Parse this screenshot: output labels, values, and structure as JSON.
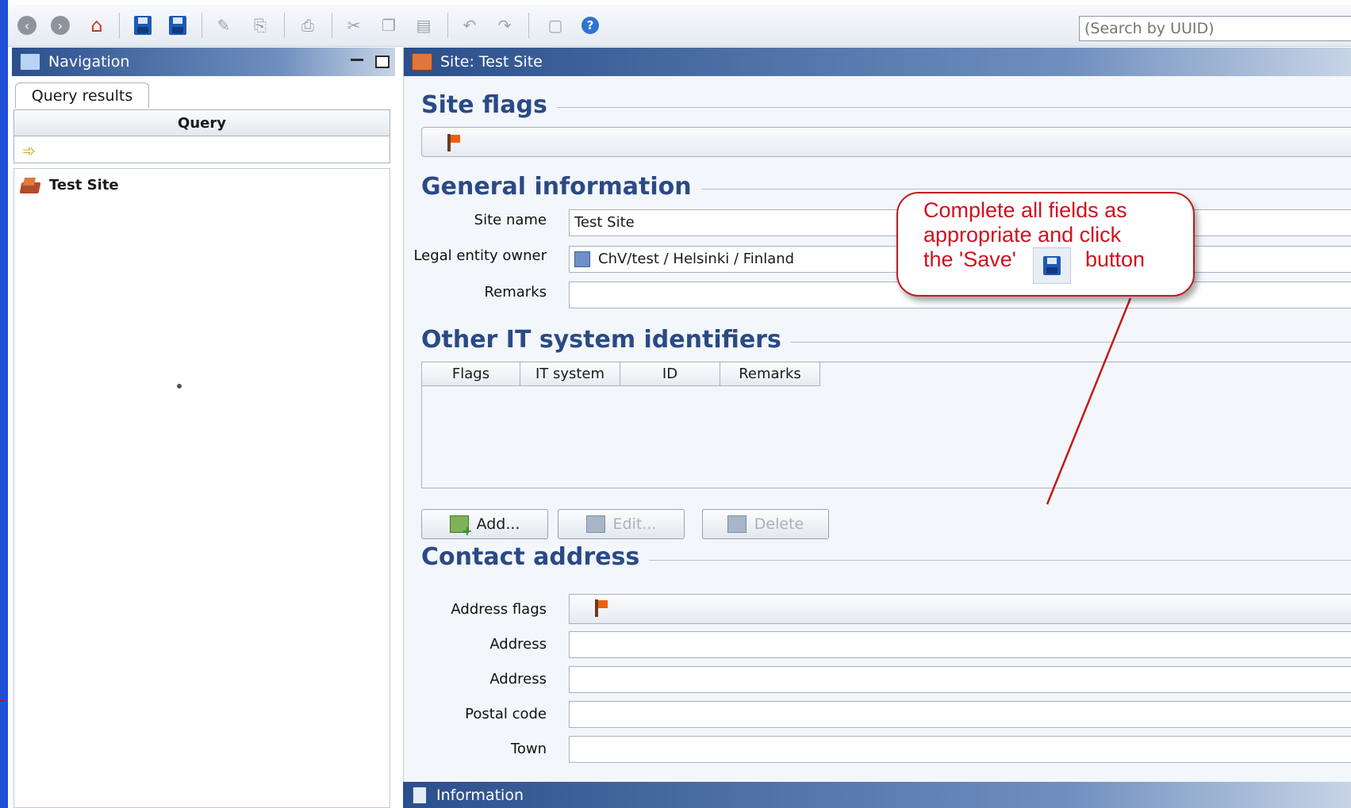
{
  "toolbar": {
    "icons": [
      "back-icon",
      "forward-icon",
      "home-icon",
      "save-icon",
      "save-all-icon",
      "edit-icon",
      "preview-icon",
      "print-icon",
      "cut-icon",
      "copy-icon",
      "paste-icon",
      "undo-icon",
      "redo-icon",
      "document-icon",
      "help-icon"
    ],
    "search_placeholder": "(Search by UUID)"
  },
  "navigation": {
    "title": "Navigation",
    "tab": "Query results",
    "query_header": "Query",
    "tree_items": [
      {
        "label": "Test Site",
        "icon": "site-icon"
      }
    ]
  },
  "site_panel": {
    "title": "Site: Test Site",
    "sections": {
      "flags": "Site flags",
      "general": "General information",
      "identifiers": "Other IT system identifiers",
      "contact": "Contact address"
    },
    "general": {
      "site_name_label": "Site name",
      "site_name_value": "Test Site",
      "owner_label": "Legal entity owner",
      "owner_value": "ChV/test / Helsinki / Finland",
      "remarks_label": "Remarks",
      "remarks_value": ""
    },
    "identifiers_table": {
      "columns": [
        "Flags",
        "IT system",
        "ID",
        "Remarks"
      ],
      "rows": []
    },
    "buttons": {
      "add": "Add...",
      "edit": "Edit...",
      "delete": "Delete"
    },
    "contact": {
      "address_flags_label": "Address flags",
      "address1_label": "Address",
      "address2_label": "Address",
      "postal_label": "Postal code",
      "town_label": "Town"
    }
  },
  "info_bar": {
    "title": "Information"
  },
  "callout": {
    "line1": "Complete all fields as",
    "line2": "appropriate and click",
    "line3a": "the 'Save'",
    "line3b": "button"
  },
  "colors": {
    "accent": "#2a4a86",
    "callout_red": "#d0111f",
    "title_bar": "#2a4f8c"
  }
}
